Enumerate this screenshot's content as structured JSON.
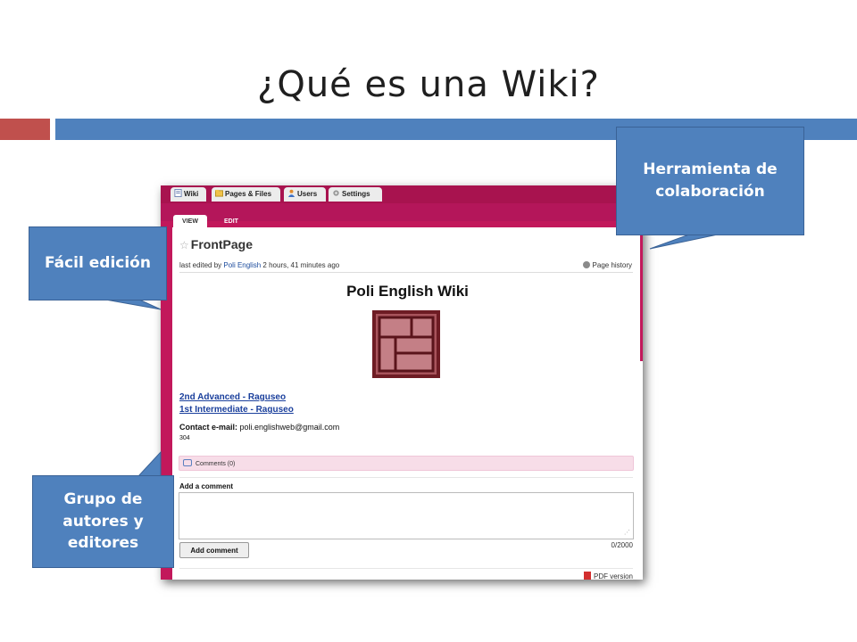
{
  "slide": {
    "title": "¿Qué es una Wiki?",
    "accent_colors": {
      "red": "#c0504d",
      "blue": "#4f81bd"
    }
  },
  "wiki": {
    "tabs": [
      {
        "label": "Wiki",
        "icon": "wiki-page-icon"
      },
      {
        "label": "Pages & Files",
        "icon": "folder-icon"
      },
      {
        "label": "Users",
        "icon": "users-icon"
      },
      {
        "label": "Settings",
        "icon": "gear-icon"
      }
    ],
    "view_tabs": {
      "view": "VIEW",
      "edit": "EDIT"
    },
    "page_title": "FrontPage",
    "last_edited": {
      "prefix": "last edited by",
      "user": "Poli English",
      "when": "2 hours, 41 minutes ago"
    },
    "page_history": "Page history",
    "content_title": "Poli English Wiki",
    "links": [
      "2nd Advanced - Raguseo",
      "1st Intermediate - Raguseo"
    ],
    "contact": {
      "label": "Contact e-mail:",
      "value": "poli.englishweb@gmail.com"
    },
    "number": "304",
    "comments": "Comments (0)",
    "add_comment_label": "Add a comment",
    "add_comment_button": "Add comment",
    "char_counter": "0/2000",
    "pdf_version": "PDF version",
    "theme_color": "#c2185b"
  },
  "callouts": {
    "herramienta": "Herramienta de colaboración",
    "facil": "Fácil edición",
    "grupo": "Grupo de autores y editores",
    "color": "#4f81bd"
  }
}
